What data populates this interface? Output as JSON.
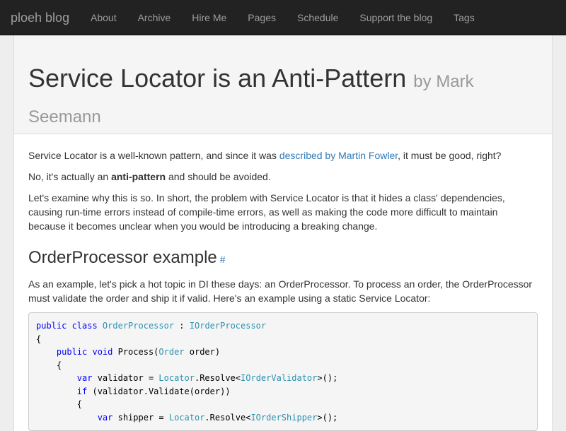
{
  "navbar": {
    "brand": "ploeh blog",
    "items": [
      {
        "label": "About"
      },
      {
        "label": "Archive"
      },
      {
        "label": "Hire Me"
      },
      {
        "label": "Pages"
      },
      {
        "label": "Schedule"
      },
      {
        "label": "Support the blog"
      },
      {
        "label": "Tags"
      }
    ]
  },
  "post": {
    "title": "Service Locator is an Anti-Pattern",
    "byline": "by Mark Seemann"
  },
  "body": {
    "p1_pre": "Service Locator is a well-known pattern, and since it was ",
    "p1_link": "described by Martin Fowler",
    "p1_post": ", it must be good, right?",
    "p2_pre": "No, it's actually an ",
    "p2_strong": "anti-pattern",
    "p2_post": " and should be avoided.",
    "p3": "Let's examine why this is so. In short, the problem with Service Locator is that it hides a class' dependencies, causing run-time errors instead of compile-time errors, as well as making the code more difficult to maintain because it becomes unclear when you would be introducing a breaking change.",
    "h2": "OrderProcessor example",
    "h2_anchor": "#",
    "p4": "As an example, let's pick a hot topic in DI these days: an OrderProcessor. To process an order, the OrderProcessor must validate the order and ship it if valid. Here's an example using a static Service Locator:"
  },
  "code": {
    "l1": {
      "a": "public class ",
      "b": "OrderProcessor",
      "c": " : ",
      "d": "IOrderProcessor"
    },
    "l2": "{",
    "l3": {
      "a": "    public void ",
      "b": "Process(",
      "c": "Order",
      "d": " order)"
    },
    "l4": "    {",
    "l5": {
      "a": "        var ",
      "b": "validator = ",
      "c": "Locator",
      "d": ".Resolve<",
      "e": "IOrderValidator",
      "f": ">();"
    },
    "l6": {
      "a": "        if ",
      "b": "(validator.Validate(order))"
    },
    "l7": "        {",
    "l8": {
      "a": "            var ",
      "b": "shipper = ",
      "c": "Locator",
      "d": ".Resolve<",
      "e": "IOrderShipper",
      "f": ">();"
    }
  }
}
